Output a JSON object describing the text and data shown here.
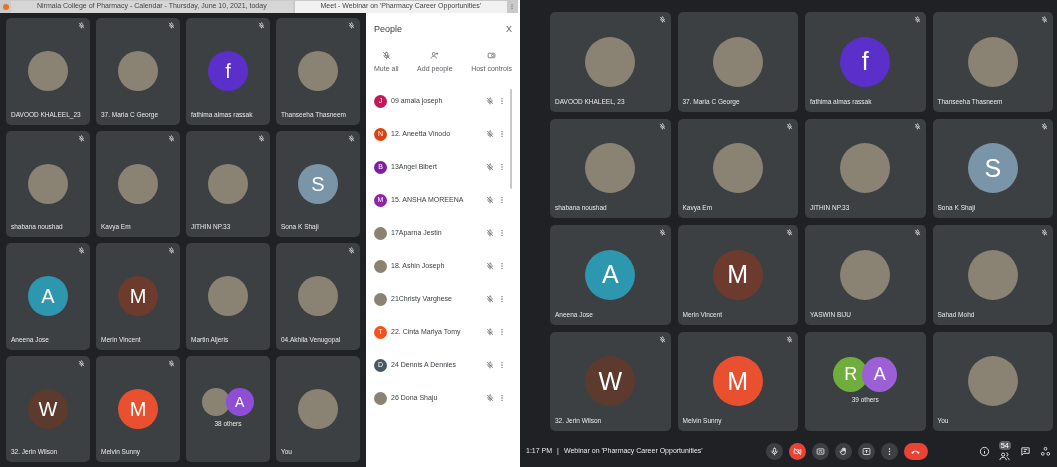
{
  "left_window": {
    "browser_tabs": [
      {
        "title": "Nirmala College of Pharmacy - Calendar - Thursday, June 10, 2021, today",
        "selected": false
      },
      {
        "title": "Meet - Webinar on 'Pharmacy Career Opportunities'",
        "selected": true
      }
    ],
    "tiles": [
      {
        "kind": "person",
        "name": "DAVOOD KHALEEL_23",
        "muted": true,
        "avatar": {
          "kind": "photo"
        }
      },
      {
        "kind": "person",
        "name": "37. Maria C George",
        "muted": true,
        "avatar": {
          "kind": "photo"
        }
      },
      {
        "kind": "person",
        "name": "fathima almas rassak",
        "muted": true,
        "avatar": {
          "kind": "letter",
          "letter": "f",
          "color": "#5b2fc9"
        }
      },
      {
        "kind": "person",
        "name": "Thanseeha Thasneem",
        "muted": true,
        "avatar": {
          "kind": "photo"
        }
      },
      {
        "kind": "person",
        "name": "shabana noushad",
        "muted": true,
        "avatar": {
          "kind": "photo"
        }
      },
      {
        "kind": "person",
        "name": "Kavya Em",
        "muted": true,
        "avatar": {
          "kind": "photo"
        }
      },
      {
        "kind": "person",
        "name": "JITHIN NP.33",
        "muted": true,
        "avatar": {
          "kind": "photo"
        }
      },
      {
        "kind": "person",
        "name": "Sona K Shaji",
        "muted": true,
        "avatar": {
          "kind": "letter",
          "letter": "S",
          "color": "#7a95a8"
        }
      },
      {
        "kind": "person",
        "name": "Aneena Jose",
        "muted": true,
        "avatar": {
          "kind": "letter",
          "letter": "A",
          "color": "#2e97b0"
        }
      },
      {
        "kind": "person",
        "name": "Merin Vincent",
        "muted": true,
        "avatar": {
          "kind": "letter",
          "letter": "M",
          "color": "#6d3b2e"
        }
      },
      {
        "kind": "person",
        "name": "Martin Aljeris",
        "muted": false,
        "avatar": {
          "kind": "photo"
        }
      },
      {
        "kind": "person",
        "name": "04.Akhila Venugopal",
        "muted": true,
        "avatar": {
          "kind": "photo"
        }
      },
      {
        "kind": "person",
        "name": "32. Jerin Wilson",
        "muted": true,
        "avatar": {
          "kind": "letter",
          "letter": "W",
          "color": "#5d3a2e"
        }
      },
      {
        "kind": "person",
        "name": "Melvin Sunny",
        "muted": true,
        "avatar": {
          "kind": "letter",
          "letter": "M",
          "color": "#e8502f"
        }
      },
      {
        "kind": "others",
        "label": "38 others",
        "muted": false,
        "avatars": [
          {
            "kind": "photo"
          },
          {
            "kind": "letter",
            "letter": "A",
            "color": "#8e4fd6"
          }
        ]
      },
      {
        "kind": "person",
        "name": "You",
        "muted": false,
        "avatar": {
          "kind": "photo"
        }
      }
    ],
    "people_panel": {
      "title": "People",
      "close": "X",
      "actions": [
        {
          "kind": "mute",
          "label": "Mute all"
        },
        {
          "kind": "add",
          "label": "Add people"
        },
        {
          "kind": "host",
          "label": "Host controls"
        }
      ],
      "participants": [
        {
          "name": "09 amala joseph",
          "avatar": {
            "kind": "letter",
            "letter": "J",
            "color": "#c2185b"
          }
        },
        {
          "name": "12. Aneetta Vinodo",
          "avatar": {
            "kind": "letter",
            "letter": "N",
            "color": "#d84315"
          }
        },
        {
          "name": "13Angel Bibert",
          "avatar": {
            "kind": "letter",
            "letter": "B",
            "color": "#7b1fa2"
          }
        },
        {
          "name": "15. ANSHA MOREENA",
          "avatar": {
            "kind": "letter",
            "letter": "M",
            "color": "#8e24aa"
          }
        },
        {
          "name": "17Aparna Jestin",
          "avatar": {
            "kind": "photo"
          }
        },
        {
          "name": "18. Ashin Joseph",
          "avatar": {
            "kind": "photo"
          }
        },
        {
          "name": "21Christy Varghese",
          "avatar": {
            "kind": "photo"
          }
        },
        {
          "name": "22. Cinta Mariya Tomy",
          "avatar": {
            "kind": "letter",
            "letter": "T",
            "color": "#f4511e"
          }
        },
        {
          "name": "24 Dennis A Dennies",
          "avatar": {
            "kind": "letter",
            "letter": "D",
            "color": "#455a64"
          }
        },
        {
          "name": "26 Dona Shaju",
          "avatar": {
            "kind": "photo"
          }
        }
      ]
    }
  },
  "right_window": {
    "tiles": [
      {
        "kind": "person",
        "name": "DAVOOD KHALEEL, 23",
        "muted": true,
        "avatar": {
          "kind": "photo"
        }
      },
      {
        "kind": "person",
        "name": "37. Maria C George",
        "muted": false,
        "avatar": {
          "kind": "photo"
        }
      },
      {
        "kind": "person",
        "name": "fathima almas rassak",
        "muted": true,
        "avatar": {
          "kind": "letter",
          "letter": "f",
          "color": "#5b2fc9"
        }
      },
      {
        "kind": "person",
        "name": "Thanseeha Thasneem",
        "muted": true,
        "avatar": {
          "kind": "photo"
        }
      },
      {
        "kind": "person",
        "name": "shabana noushad",
        "muted": true,
        "avatar": {
          "kind": "photo"
        }
      },
      {
        "kind": "person",
        "name": "Kavya Em",
        "muted": true,
        "avatar": {
          "kind": "photo"
        }
      },
      {
        "kind": "person",
        "name": "JITHIN NP.33",
        "muted": true,
        "avatar": {
          "kind": "photo"
        }
      },
      {
        "kind": "person",
        "name": "Sona K Shaji",
        "muted": true,
        "avatar": {
          "kind": "letter",
          "letter": "S",
          "color": "#7a95a8"
        }
      },
      {
        "kind": "person",
        "name": "Aneena Jose",
        "muted": true,
        "avatar": {
          "kind": "letter",
          "letter": "A",
          "color": "#2e97b0"
        }
      },
      {
        "kind": "person",
        "name": "Merin Vincent",
        "muted": true,
        "avatar": {
          "kind": "letter",
          "letter": "M",
          "color": "#6d3b2e"
        }
      },
      {
        "kind": "person",
        "name": "YASWIN BIJU",
        "muted": true,
        "avatar": {
          "kind": "photo"
        }
      },
      {
        "kind": "person",
        "name": "Sahad Mohd",
        "muted": true,
        "avatar": {
          "kind": "photo"
        }
      },
      {
        "kind": "person",
        "name": "32. Jerin Wilson",
        "muted": true,
        "avatar": {
          "kind": "letter",
          "letter": "W",
          "color": "#5d3a2e"
        }
      },
      {
        "kind": "person",
        "name": "Melvin Sunny",
        "muted": true,
        "avatar": {
          "kind": "letter",
          "letter": "M",
          "color": "#e8502f"
        }
      },
      {
        "kind": "others",
        "label": "39 others",
        "muted": false,
        "avatars": [
          {
            "kind": "letter",
            "letter": "R",
            "color": "#6fae3c"
          },
          {
            "kind": "letter",
            "letter": "A",
            "color": "#9c5fd6"
          }
        ]
      },
      {
        "kind": "person",
        "name": "You",
        "muted": false,
        "avatar": {
          "kind": "photo"
        }
      }
    ],
    "bottom_bar": {
      "time": "1:17 PM",
      "separator": "|",
      "meeting_title": "Webinar on 'Pharmacy Career Opportunities'",
      "camera_on": false,
      "participant_count": "54"
    }
  }
}
